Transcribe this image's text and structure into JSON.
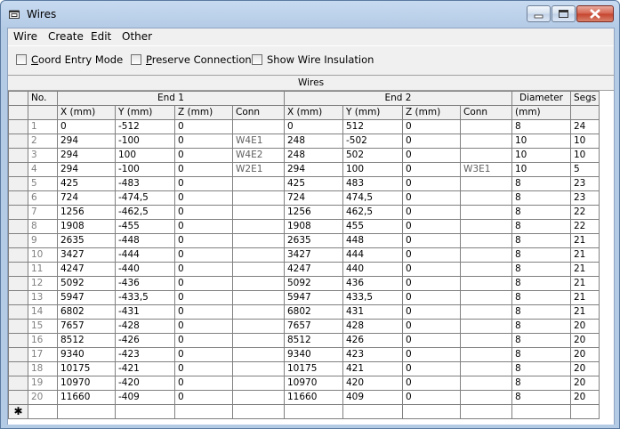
{
  "window": {
    "title": "Wires"
  },
  "menu": [
    "Wire",
    "Create",
    "Edit",
    "Other"
  ],
  "options": [
    {
      "label_pre": "",
      "accel": "C",
      "label_post": "oord Entry Mode",
      "checked": false
    },
    {
      "label_pre": "",
      "accel": "P",
      "label_post": "reserve Connections",
      "checked": false
    },
    {
      "label_pre": "Show Wire Insulation",
      "accel": "",
      "label_post": "",
      "checked": false
    }
  ],
  "grid": {
    "caption": "Wires",
    "header1": {
      "no": "No.",
      "end1": "End 1",
      "end2": "End 2",
      "diameter": "Diameter",
      "segs": "Segs"
    },
    "header2": {
      "x1": "X  (mm)",
      "y1": "Y  (mm)",
      "z1": "Z  (mm)",
      "conn1": "Conn",
      "x2": "X  (mm)",
      "y2": "Y  (mm)",
      "z2": "Z  (mm)",
      "conn2": "Conn",
      "diam_unit": "(mm)"
    },
    "new_row_marker": "✱",
    "rows": [
      {
        "no": "1",
        "x1": "0",
        "y1": "-512",
        "z1": "0",
        "conn1": "",
        "x2": "0",
        "y2": "512",
        "z2": "0",
        "conn2": "",
        "diam": "8",
        "segs": "24"
      },
      {
        "no": "2",
        "x1": "294",
        "y1": "-100",
        "z1": "0",
        "conn1": "W4E1",
        "x2": "248",
        "y2": "-502",
        "z2": "0",
        "conn2": "",
        "diam": "10",
        "segs": "10"
      },
      {
        "no": "3",
        "x1": "294",
        "y1": "100",
        "z1": "0",
        "conn1": "W4E2",
        "x2": "248",
        "y2": "502",
        "z2": "0",
        "conn2": "",
        "diam": "10",
        "segs": "10"
      },
      {
        "no": "4",
        "x1": "294",
        "y1": "-100",
        "z1": "0",
        "conn1": "W2E1",
        "x2": "294",
        "y2": "100",
        "z2": "0",
        "conn2": "W3E1",
        "diam": "10",
        "segs": "5"
      },
      {
        "no": "5",
        "x1": "425",
        "y1": "-483",
        "z1": "0",
        "conn1": "",
        "x2": "425",
        "y2": "483",
        "z2": "0",
        "conn2": "",
        "diam": "8",
        "segs": "23"
      },
      {
        "no": "6",
        "x1": "724",
        "y1": "-474,5",
        "z1": "0",
        "conn1": "",
        "x2": "724",
        "y2": "474,5",
        "z2": "0",
        "conn2": "",
        "diam": "8",
        "segs": "23"
      },
      {
        "no": "7",
        "x1": "1256",
        "y1": "-462,5",
        "z1": "0",
        "conn1": "",
        "x2": "1256",
        "y2": "462,5",
        "z2": "0",
        "conn2": "",
        "diam": "8",
        "segs": "22"
      },
      {
        "no": "8",
        "x1": "1908",
        "y1": "-455",
        "z1": "0",
        "conn1": "",
        "x2": "1908",
        "y2": "455",
        "z2": "0",
        "conn2": "",
        "diam": "8",
        "segs": "22"
      },
      {
        "no": "9",
        "x1": "2635",
        "y1": "-448",
        "z1": "0",
        "conn1": "",
        "x2": "2635",
        "y2": "448",
        "z2": "0",
        "conn2": "",
        "diam": "8",
        "segs": "21"
      },
      {
        "no": "10",
        "x1": "3427",
        "y1": "-444",
        "z1": "0",
        "conn1": "",
        "x2": "3427",
        "y2": "444",
        "z2": "0",
        "conn2": "",
        "diam": "8",
        "segs": "21"
      },
      {
        "no": "11",
        "x1": "4247",
        "y1": "-440",
        "z1": "0",
        "conn1": "",
        "x2": "4247",
        "y2": "440",
        "z2": "0",
        "conn2": "",
        "diam": "8",
        "segs": "21"
      },
      {
        "no": "12",
        "x1": "5092",
        "y1": "-436",
        "z1": "0",
        "conn1": "",
        "x2": "5092",
        "y2": "436",
        "z2": "0",
        "conn2": "",
        "diam": "8",
        "segs": "21"
      },
      {
        "no": "13",
        "x1": "5947",
        "y1": "-433,5",
        "z1": "0",
        "conn1": "",
        "x2": "5947",
        "y2": "433,5",
        "z2": "0",
        "conn2": "",
        "diam": "8",
        "segs": "21"
      },
      {
        "no": "14",
        "x1": "6802",
        "y1": "-431",
        "z1": "0",
        "conn1": "",
        "x2": "6802",
        "y2": "431",
        "z2": "0",
        "conn2": "",
        "diam": "8",
        "segs": "21"
      },
      {
        "no": "15",
        "x1": "7657",
        "y1": "-428",
        "z1": "0",
        "conn1": "",
        "x2": "7657",
        "y2": "428",
        "z2": "0",
        "conn2": "",
        "diam": "8",
        "segs": "20"
      },
      {
        "no": "16",
        "x1": "8512",
        "y1": "-426",
        "z1": "0",
        "conn1": "",
        "x2": "8512",
        "y2": "426",
        "z2": "0",
        "conn2": "",
        "diam": "8",
        "segs": "20"
      },
      {
        "no": "17",
        "x1": "9340",
        "y1": "-423",
        "z1": "0",
        "conn1": "",
        "x2": "9340",
        "y2": "423",
        "z2": "0",
        "conn2": "",
        "diam": "8",
        "segs": "20"
      },
      {
        "no": "18",
        "x1": "10175",
        "y1": "-421",
        "z1": "0",
        "conn1": "",
        "x2": "10175",
        "y2": "421",
        "z2": "0",
        "conn2": "",
        "diam": "8",
        "segs": "20"
      },
      {
        "no": "19",
        "x1": "10970",
        "y1": "-420",
        "z1": "0",
        "conn1": "",
        "x2": "10970",
        "y2": "420",
        "z2": "0",
        "conn2": "",
        "diam": "8",
        "segs": "20"
      },
      {
        "no": "20",
        "x1": "11660",
        "y1": "-409",
        "z1": "0",
        "conn1": "",
        "x2": "11660",
        "y2": "409",
        "z2": "0",
        "conn2": "",
        "diam": "8",
        "segs": "20"
      }
    ]
  }
}
